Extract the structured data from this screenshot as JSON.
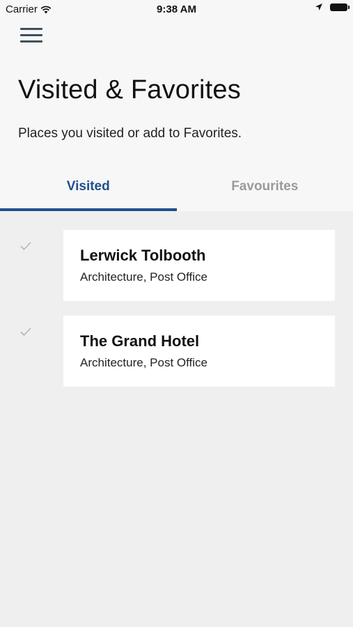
{
  "status_bar": {
    "carrier": "Carrier",
    "time": "9:38 AM",
    "icons": [
      "wifi-icon",
      "location-arrow-icon",
      "battery-icon"
    ]
  },
  "header": {
    "menu_icon": "hamburger-menu-icon",
    "title": "Visited & Favorites",
    "subtitle": "Places you visited or add to Favorites."
  },
  "tabs": [
    {
      "label": "Visited",
      "active": true
    },
    {
      "label": "Favourites",
      "active": false
    }
  ],
  "items": [
    {
      "name": "Lerwick Tolbooth",
      "categories": "Architecture, Post Office",
      "visited": true
    },
    {
      "name": "The Grand Hotel",
      "categories": "Architecture, Post Office",
      "visited": true
    }
  ],
  "colors": {
    "accent": "#1f4f8f",
    "tab_inactive": "#9a9a9a",
    "header_bg": "#f7f7f7",
    "list_bg": "#efefef",
    "check": "#b5b5b5"
  }
}
